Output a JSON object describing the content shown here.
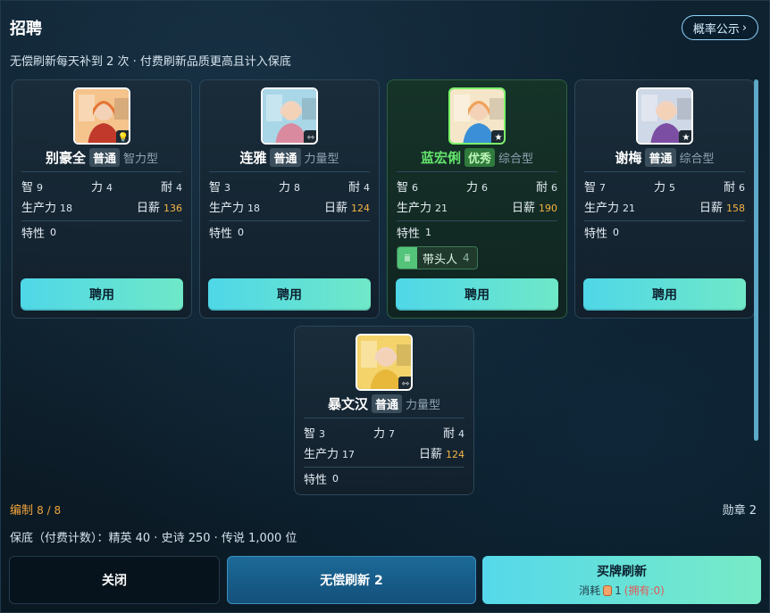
{
  "header": {
    "title": "招聘",
    "prob_button": "概率公示",
    "prob_chevron": "›",
    "subtitle": "无偿刷新每天补到 2 次 · 付费刷新品质更高且计入保底"
  },
  "labels": {
    "zhi": "智",
    "li": "力",
    "nai": "耐",
    "productivity": "生产力",
    "salary": "日薪",
    "trait": "特性",
    "hire": "聘用"
  },
  "candidates": [
    {
      "name": "别豪全",
      "grade": "普通",
      "type": "智力型",
      "zhi": "9",
      "li": "4",
      "nai": "4",
      "productivity": "18",
      "salary": "136",
      "trait_count": "0",
      "badge_icon": "lightbulb-icon",
      "badge": "💡"
    },
    {
      "name": "连雅",
      "grade": "普通",
      "type": "力量型",
      "zhi": "3",
      "li": "8",
      "nai": "4",
      "productivity": "18",
      "salary": "124",
      "trait_count": "0",
      "badge_icon": "dumbbell-icon",
      "badge": "⇿"
    },
    {
      "name": "蓝宏俐",
      "grade": "优秀",
      "type": "综合型",
      "zhi": "6",
      "li": "6",
      "nai": "6",
      "productivity": "21",
      "salary": "190",
      "trait_count": "1",
      "badge_icon": "star-icon",
      "badge": "★",
      "trait_tag": {
        "label": "带头人",
        "level": "4",
        "icon": "group-icon",
        "glyph": "ⅲ"
      }
    },
    {
      "name": "谢梅",
      "grade": "普通",
      "type": "综合型",
      "zhi": "7",
      "li": "5",
      "nai": "6",
      "productivity": "21",
      "salary": "158",
      "trait_count": "0",
      "badge_icon": "star-icon",
      "badge": "★"
    },
    {
      "name": "暴文汉",
      "grade": "普通",
      "type": "力量型",
      "zhi": "3",
      "li": "7",
      "nai": "4",
      "productivity": "17",
      "salary": "124",
      "trait_count": "0",
      "badge_icon": "dumbbell-icon",
      "badge": "⇿"
    }
  ],
  "footer": {
    "bianzhi_label": "编制",
    "bianzhi_value": "8 / 8",
    "medals": "勋章 2",
    "pity": "保底（付费计数）：精英 40 · 史诗 250 · 传说 1,000 位",
    "close": "关闭",
    "free_refresh": "无偿刷新 2",
    "buy_refresh": "买牌刷新",
    "buy_cost_label": "消耗",
    "buy_cost_value": "1",
    "buy_own": "(拥有:0)"
  },
  "colors": {
    "accent_button": "#55d8ea",
    "salary": "#f6b545",
    "good_grade": "#63e36b"
  }
}
